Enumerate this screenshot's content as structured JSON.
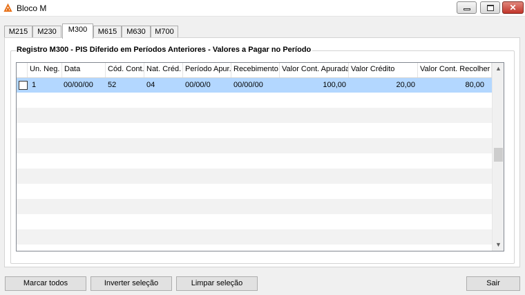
{
  "window": {
    "title": "Bloco M",
    "icon": "app-logo-icon",
    "controls": {
      "minimize": "minimize-icon",
      "maximize": "maximize-icon",
      "close": "close-icon"
    }
  },
  "tabs": [
    "M215",
    "M230",
    "M300",
    "M615",
    "M630",
    "M700"
  ],
  "active_tab": "M300",
  "group": {
    "title": "Registro M300 - PIS Diferido em Períodos Anteriores - Valores a Pagar no Período"
  },
  "grid": {
    "columns": [
      "Un. Neg.",
      "Data",
      "Cód. Cont.",
      "Nat. Créd.",
      "Período Apur.",
      "Recebimento",
      "Valor Cont. Apurada",
      "Valor Crédito",
      "Valor Cont. Recolher"
    ],
    "rows": [
      {
        "selected": true,
        "checked": false,
        "un_neg": "1",
        "data": "00/00/00",
        "cod_cont": "52",
        "nat_cred": "04",
        "periodo_apur": "00/00/0",
        "recebimento": "00/00/00",
        "valor_cont_apurada": "100,00",
        "valor_credito": "20,00",
        "valor_cont_recolher": "80,00"
      }
    ]
  },
  "buttons": {
    "marcar": "Marcar todos",
    "inverter": "Inverter seleção",
    "limpar": "Limpar seleção",
    "sair": "Sair"
  },
  "colors": {
    "selection": "#b3d7ff",
    "alt_row": "#f2f2f2",
    "close_button": "#c2352a"
  }
}
